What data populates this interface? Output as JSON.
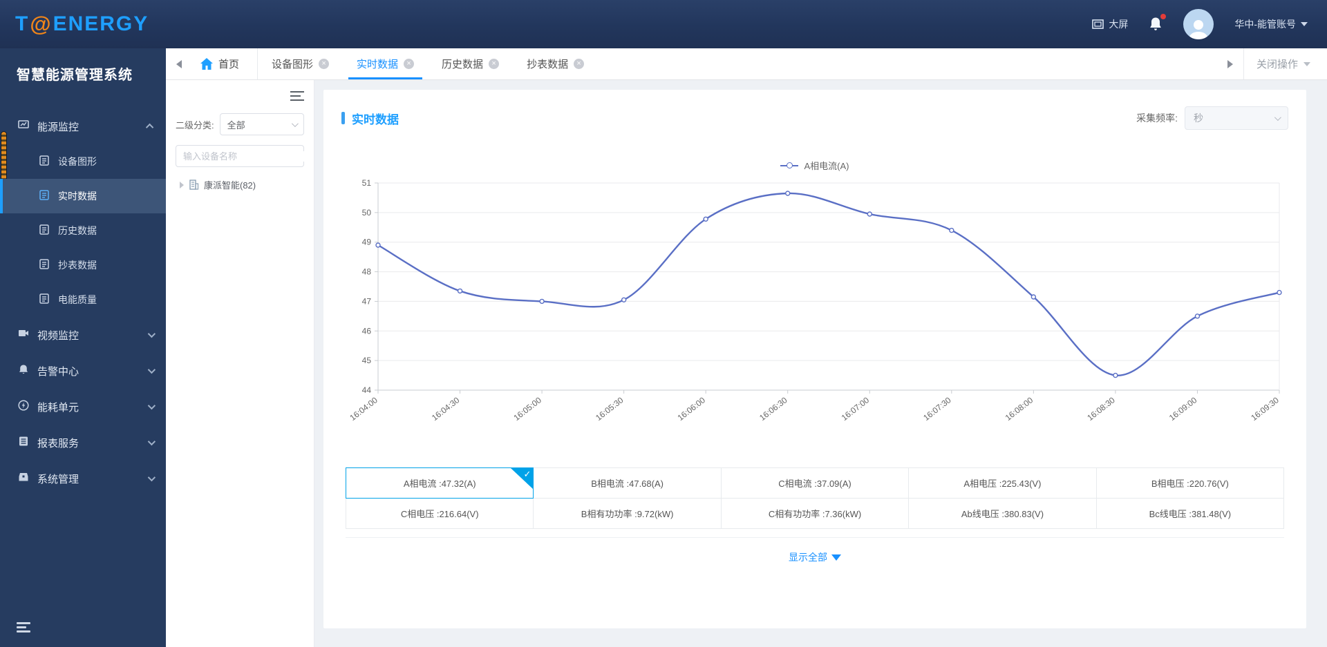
{
  "header": {
    "logo_t": "T",
    "logo_at": "@",
    "logo_rest": "ENERGY",
    "big_screen_label": "大屏",
    "account": "华中-能管账号"
  },
  "sidebar": {
    "title": "智慧能源管理系统",
    "menu": [
      {
        "label": "能源监控",
        "icon": "monitor-icon",
        "expanded": true,
        "children": [
          "设备图形",
          "实时数据",
          "历史数据",
          "抄表数据",
          "电能质量"
        ],
        "active_child": "实时数据"
      },
      {
        "label": "视频监控",
        "icon": "video-icon"
      },
      {
        "label": "告警中心",
        "icon": "alarm-icon"
      },
      {
        "label": "能耗单元",
        "icon": "energy-icon"
      },
      {
        "label": "报表服务",
        "icon": "report-icon"
      },
      {
        "label": "系统管理",
        "icon": "system-icon"
      }
    ]
  },
  "tabs": {
    "home": "首页",
    "items": [
      {
        "label": "设备图形",
        "active": false
      },
      {
        "label": "实时数据",
        "active": true
      },
      {
        "label": "历史数据",
        "active": false
      },
      {
        "label": "抄表数据",
        "active": false
      }
    ],
    "close_ops": "关闭操作"
  },
  "device_panel": {
    "category_label": "二级分类:",
    "category_value": "全部",
    "search_placeholder": "输入设备名称",
    "tree_item": "康派智能(82)"
  },
  "main": {
    "title": "实时数据",
    "freq_label": "采集频率:",
    "freq_value": "秒",
    "show_all": "显示全部",
    "table": {
      "rows": [
        [
          {
            "label": "A相电流 :47.32(A)",
            "selected": true
          },
          {
            "label": "B相电流 :47.68(A)"
          },
          {
            "label": "C相电流 :37.09(A)"
          },
          {
            "label": "A相电压 :225.43(V)"
          },
          {
            "label": "B相电压 :220.76(V)"
          }
        ],
        [
          {
            "label": "C相电压 :216.64(V)"
          },
          {
            "label": "B相有功功率 :9.72(kW)"
          },
          {
            "label": "C相有功功率 :7.36(kW)"
          },
          {
            "label": "Ab线电压 :380.83(V)"
          },
          {
            "label": "Bc线电压 :381.48(V)"
          }
        ]
      ]
    }
  },
  "chart_data": {
    "type": "line",
    "title": "",
    "legend_position": "top-center",
    "grid": true,
    "smooth": true,
    "line_color": "#5a6fc5",
    "ylim": [
      44,
      51
    ],
    "yticks": [
      44,
      45,
      46,
      47,
      48,
      49,
      50,
      51
    ],
    "x_labels": [
      "16:04:00",
      "16:04:30",
      "16:05:00",
      "16:05:30",
      "16:06:00",
      "16:06:30",
      "16:07:00",
      "16:07:30",
      "16:08:00",
      "16:08:30",
      "16:09:00",
      "16:09:30"
    ],
    "series": [
      {
        "name": "A相电流(A)",
        "values": [
          48.9,
          47.35,
          47.0,
          47.05,
          49.78,
          50.65,
          49.95,
          49.4,
          47.15,
          44.5,
          46.5,
          47.3
        ]
      }
    ]
  }
}
